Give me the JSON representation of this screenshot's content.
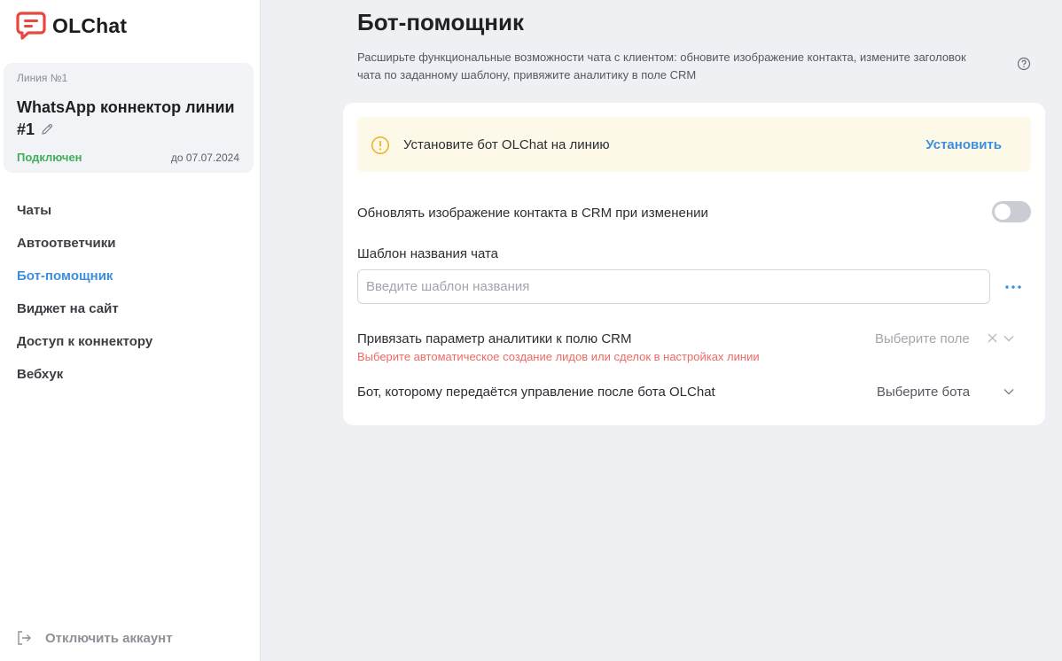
{
  "brand": {
    "name": "OLChat",
    "accent": "#e8473f",
    "link_color": "#3d8fdd"
  },
  "line": {
    "number": "Линия №1",
    "title": "WhatsApp коннектор линии #1",
    "status": "Подключен",
    "until": "до 07.07.2024"
  },
  "nav": {
    "items": [
      {
        "label": "Чаты"
      },
      {
        "label": "Автоответчики"
      },
      {
        "label": "Бот-помощник"
      },
      {
        "label": "Виджет на сайт"
      },
      {
        "label": "Доступ к коннектору"
      },
      {
        "label": "Вебхук"
      }
    ],
    "active": "Бот-помощник"
  },
  "logout": {
    "label": "Отключить аккаунт",
    "icon": "logout-icon"
  },
  "page": {
    "title": "Бот-помощник",
    "description": "Расширьте функциональные возможности чата с клиентом: обновите изображение контакта, измените заголовок чата по заданному шаблону, привяжите аналитику в поле CRM",
    "help_icon": "question-circle-icon"
  },
  "banner": {
    "text": "Установите бот OLChat на линию",
    "action": "Установить",
    "icon": "warning-circle-icon"
  },
  "settings": {
    "update_avatar": {
      "label": "Обновлять изображение контакта в CRM при изменении",
      "enabled": false
    },
    "chat_template": {
      "label": "Шаблон названия чата",
      "value": "",
      "placeholder": "Введите шаблон названия"
    },
    "analytics": {
      "label": "Привязать параметр аналитики к полю CRM",
      "warning": "Выберите автоматическое создание лидов или сделок в настройках линии",
      "select_placeholder": "Выберите поле"
    },
    "next_bot": {
      "label": "Бот, которому передаётся управление после бота OLChat",
      "select_placeholder": "Выберите бота"
    }
  }
}
